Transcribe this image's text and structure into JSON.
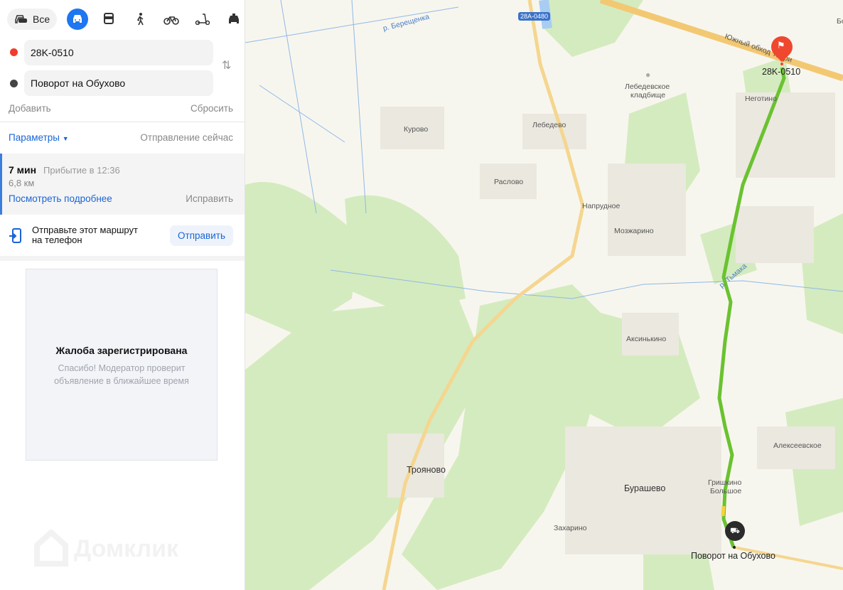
{
  "modes": {
    "all_label": "Все",
    "items": [
      "car",
      "bus",
      "pedestrian",
      "bicycle",
      "scooter",
      "taxi"
    ],
    "active": "car"
  },
  "route": {
    "from": "28K-0510",
    "to": "Поворот на Обухово",
    "add": "Добавить",
    "reset": "Сбросить",
    "params": "Параметры",
    "departure": "Отправление сейчас"
  },
  "result": {
    "time": "7 мин",
    "arrival": "Прибытие в 12:36",
    "distance": "6,8 км",
    "details": "Посмотреть подробнее",
    "fix": "Исправить"
  },
  "send": {
    "text_line1": "Отправьте этот маршрут",
    "text_line2": "на телефон",
    "button": "Отправить"
  },
  "complaint": {
    "title": "Жалоба зарегистрирована",
    "text_line1": "Спасибо! Модератор проверит",
    "text_line2": "объявление в ближайшее время"
  },
  "watermark": "Домклик",
  "colors": {
    "accent": "#1e76f0",
    "route": "#6ac230",
    "start": "#f23a2f",
    "end": "#333333"
  },
  "map": {
    "road_badge": "28A-0480",
    "start_label": "28K-0510",
    "end_label": "Поворот на Обухово",
    "labels": {
      "river1": "р. Берещенка",
      "highway": "Южный обход Твери",
      "cemetery1": "Лебедевское",
      "cemetery2": "кладбище",
      "negotino": "Неготино",
      "kurovo": "Курово",
      "lebedevo": "Лебедево",
      "raslovo": "Раслово",
      "naprudnoe": "Напрудное",
      "mozharino": "Мозжарино",
      "river2": "р. Тьмака",
      "aksinkino": "Аксинькино",
      "alekseevskoe": "Алексеевское",
      "troyanovo": "Трояново",
      "burashevo": "Бурашево",
      "grishkino1": "Гришкино",
      "grishkino2": "Большое",
      "zakharino": "Захарино",
      "edge": "Бо"
    }
  }
}
